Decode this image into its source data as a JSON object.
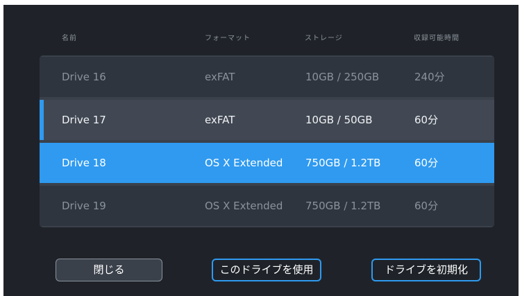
{
  "header": {
    "name": "名前",
    "format": "フォーマット",
    "storage": "ストレージ",
    "recording_time": "収録可能時間"
  },
  "drives": [
    {
      "name": "Drive 16",
      "format": "exFAT",
      "storage": "10GB / 250GB",
      "time": "240分",
      "state": "inactive"
    },
    {
      "name": "Drive 17",
      "format": "exFAT",
      "storage": "10GB / 50GB",
      "time": "60分",
      "state": "current"
    },
    {
      "name": "Drive 18",
      "format": "OS X Extended",
      "storage": "750GB / 1.2TB",
      "time": "60分",
      "state": "selected"
    },
    {
      "name": "Drive 19",
      "format": "OS X Extended",
      "storage": "750GB / 1.2TB",
      "time": "60分",
      "state": "inactive"
    }
  ],
  "buttons": {
    "close": "閉じる",
    "use_drive": "このドライブを使用",
    "format_drive": "ドライブを初期化"
  },
  "colors": {
    "background": "#1f2329",
    "accent": "#2f9af0",
    "row_inactive": "#2f353e",
    "row_current": "#414853",
    "text_dim": "#8a929c"
  }
}
